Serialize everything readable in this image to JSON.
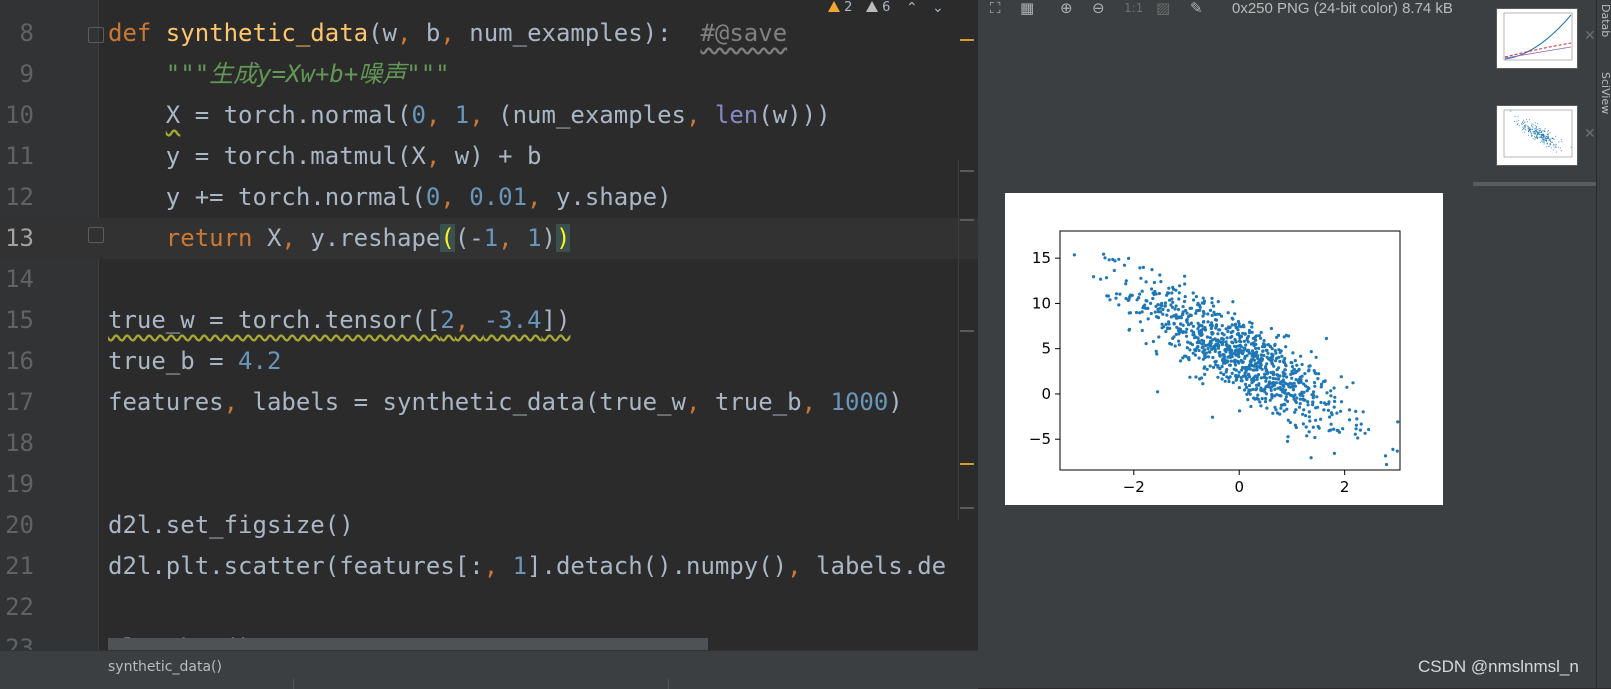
{
  "editor": {
    "inspections": {
      "warnings": "2",
      "weak_warnings": "6"
    },
    "lines": [
      {
        "n": "8",
        "current": false,
        "tokens": [
          {
            "t": "def ",
            "c": "kw"
          },
          {
            "t": "synthetic_data",
            "c": "fn"
          },
          {
            "t": "(w",
            "c": ""
          },
          {
            "t": ", ",
            "c": "kw"
          },
          {
            "t": "b",
            "c": ""
          },
          {
            "t": ", ",
            "c": "kw"
          },
          {
            "t": "num_examples):  ",
            "c": ""
          },
          {
            "t": "#@save",
            "c": "cm"
          }
        ]
      },
      {
        "n": "9",
        "current": false,
        "tokens": [
          {
            "t": "    ",
            "c": ""
          },
          {
            "t": "\"\"\"生成y=Xw+b+噪声\"\"\"",
            "c": "doc"
          }
        ]
      },
      {
        "n": "10",
        "current": false,
        "tokens": [
          {
            "t": "    ",
            "c": ""
          },
          {
            "t": "X",
            "c": "wavy"
          },
          {
            "t": " = torch.normal(",
            "c": ""
          },
          {
            "t": "0",
            "c": "num"
          },
          {
            "t": ", ",
            "c": "kw"
          },
          {
            "t": "1",
            "c": "num"
          },
          {
            "t": ", ",
            "c": "kw"
          },
          {
            "t": "(num_examples",
            "c": ""
          },
          {
            "t": ", ",
            "c": "kw"
          },
          {
            "t": "len",
            "c": "bi"
          },
          {
            "t": "(w)))",
            "c": ""
          }
        ]
      },
      {
        "n": "11",
        "current": false,
        "tokens": [
          {
            "t": "    y = torch.matmul(X",
            "c": ""
          },
          {
            "t": ", ",
            "c": "kw"
          },
          {
            "t": "w) + b",
            "c": ""
          }
        ]
      },
      {
        "n": "12",
        "current": false,
        "tokens": [
          {
            "t": "    y += torch.normal(",
            "c": ""
          },
          {
            "t": "0",
            "c": "num"
          },
          {
            "t": ", ",
            "c": "kw"
          },
          {
            "t": "0.01",
            "c": "num"
          },
          {
            "t": ", ",
            "c": "kw"
          },
          {
            "t": "y.shape)",
            "c": ""
          }
        ]
      },
      {
        "n": "13",
        "current": true,
        "tokens": [
          {
            "t": "    ",
            "c": ""
          },
          {
            "t": "return ",
            "c": "kw"
          },
          {
            "t": "X",
            "c": ""
          },
          {
            "t": ", ",
            "c": "kw"
          },
          {
            "t": "y.reshape",
            "c": ""
          },
          {
            "t": "(",
            "c": "brace"
          },
          {
            "t": "(-",
            "c": ""
          },
          {
            "t": "1",
            "c": "num"
          },
          {
            "t": ", ",
            "c": "kw"
          },
          {
            "t": "1",
            "c": "num"
          },
          {
            "t": ")",
            "c": ""
          },
          {
            "t": ")",
            "c": "brace"
          }
        ]
      },
      {
        "n": "14",
        "current": false,
        "tokens": []
      },
      {
        "n": "15",
        "current": false,
        "tokens": [
          {
            "t": "true_w = torch.tensor([",
            "c": "wavy"
          },
          {
            "t": "2",
            "c": "num wavy"
          },
          {
            "t": ", ",
            "c": "kw wavy"
          },
          {
            "t": "-3.4",
            "c": "num wavy"
          },
          {
            "t": "])",
            "c": "wavy"
          }
        ]
      },
      {
        "n": "16",
        "current": false,
        "tokens": [
          {
            "t": "true_b = ",
            "c": ""
          },
          {
            "t": "4.2",
            "c": "num"
          }
        ]
      },
      {
        "n": "17",
        "current": false,
        "tokens": [
          {
            "t": "features",
            "c": ""
          },
          {
            "t": ", ",
            "c": "kw"
          },
          {
            "t": "labels = synthetic_data(true_w",
            "c": ""
          },
          {
            "t": ", ",
            "c": "kw"
          },
          {
            "t": "true_b",
            "c": ""
          },
          {
            "t": ", ",
            "c": "kw"
          },
          {
            "t": "1000",
            "c": "num"
          },
          {
            "t": ")",
            "c": ""
          }
        ]
      },
      {
        "n": "18",
        "current": false,
        "tokens": []
      },
      {
        "n": "19",
        "current": false,
        "tokens": []
      },
      {
        "n": "20",
        "current": false,
        "tokens": [
          {
            "t": "d2l.set_figsize()",
            "c": ""
          }
        ]
      },
      {
        "n": "21",
        "current": false,
        "tokens": [
          {
            "t": "d2l.plt.scatter(features[:",
            "c": ""
          },
          {
            "t": ", ",
            "c": "kw"
          },
          {
            "t": "1",
            "c": "num"
          },
          {
            "t": "].detach().numpy()",
            "c": ""
          },
          {
            "t": ", ",
            "c": "kw"
          },
          {
            "t": "labels.de",
            "c": ""
          }
        ]
      },
      {
        "n": "22",
        "current": false,
        "tokens": []
      },
      {
        "n": "23",
        "current": false,
        "tokens": [
          {
            "t": "plt.show()",
            "c": ""
          }
        ]
      }
    ]
  },
  "statusbar": {
    "breadcrumb": "synthetic_data()"
  },
  "viewer": {
    "image_info": "0x250 PNG (24-bit color) 8.74 kB",
    "side_tab_top": "Datab",
    "side_tab": "SciView",
    "watermark": "CSDN @nmslnmsl_n",
    "toolbar_icons": [
      "fit-screen-icon",
      "grid-icon",
      "zoom-in-icon",
      "zoom-out-icon",
      "actual-size-icon",
      "background-icon",
      "color-picker-icon"
    ]
  },
  "chart_data": {
    "type": "scatter",
    "title": "",
    "xlabel": "",
    "ylabel": "",
    "xlim": [
      -3.4,
      3.05
    ],
    "ylim": [
      -8.4,
      18.0
    ],
    "xticks": [
      -2,
      0,
      2
    ],
    "yticks": [
      -5,
      0,
      5,
      10,
      15
    ],
    "xtick_labels": [
      "−2",
      "0",
      "2"
    ],
    "ytick_labels": [
      "−5",
      "0",
      "5",
      "10",
      "15"
    ],
    "grid": false,
    "color": "#1f77b4",
    "relationship": {
      "slope": -3.4,
      "intercept": 4.2,
      "noise_sd": 2.2,
      "x_mean": 0,
      "x_sd": 1,
      "n": 1000
    }
  }
}
